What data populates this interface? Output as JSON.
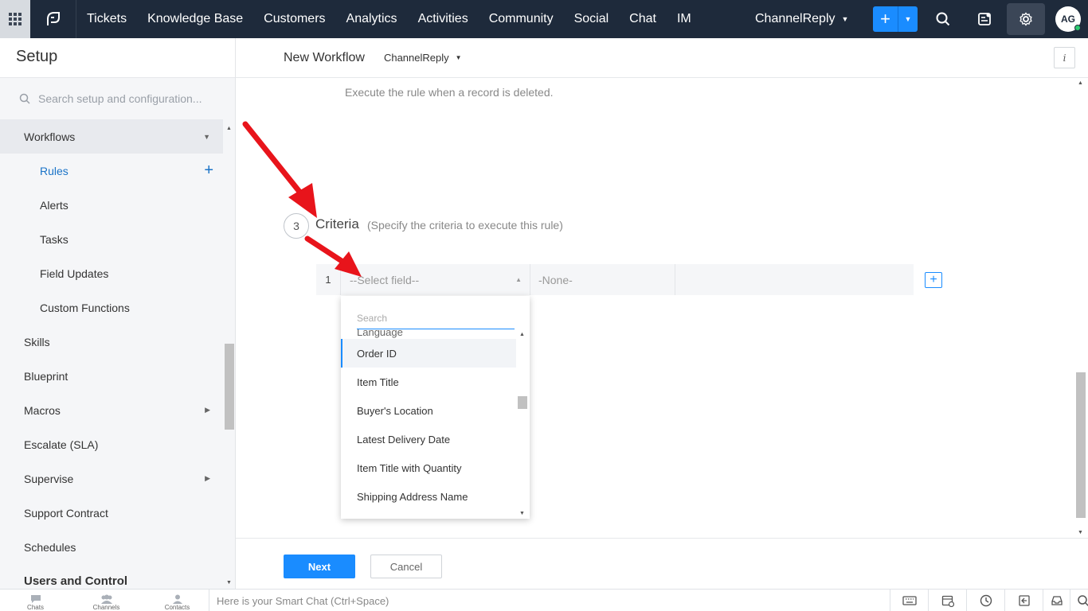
{
  "topnav": {
    "items": [
      "Tickets",
      "Knowledge Base",
      "Customers",
      "Analytics",
      "Activities",
      "Community",
      "Social",
      "Chat",
      "IM"
    ],
    "department": "ChannelReply",
    "avatar_initials": "AG"
  },
  "sidebar": {
    "title": "Setup",
    "search_placeholder": "Search setup and configuration...",
    "items": [
      {
        "label": "Workflows"
      },
      {
        "label": "Rules"
      },
      {
        "label": "Alerts"
      },
      {
        "label": "Tasks"
      },
      {
        "label": "Field Updates"
      },
      {
        "label": "Custom Functions"
      },
      {
        "label": "Skills"
      },
      {
        "label": "Blueprint"
      },
      {
        "label": "Macros"
      },
      {
        "label": "Escalate (SLA)"
      },
      {
        "label": "Supervise"
      },
      {
        "label": "Support Contract"
      },
      {
        "label": "Schedules"
      },
      {
        "label": "Users and Control"
      }
    ]
  },
  "main": {
    "title": "New Workflow",
    "department": "ChannelReply",
    "info_label": "i",
    "delete_text": "Execute the rule when a record is deleted.",
    "criteria": {
      "step": "3",
      "title": "Criteria",
      "description": "(Specify the criteria to execute this rule)",
      "row_number": "1",
      "field_placeholder": "--Select field--",
      "condition_placeholder": "-None-"
    },
    "dropdown": {
      "search_placeholder": "Search",
      "partial_item": "Language",
      "items": [
        "Order ID",
        "Item Title",
        "Buyer's Location",
        "Latest Delivery Date",
        "Item Title with Quantity",
        "Shipping Address Name"
      ]
    },
    "next_label": "Next",
    "cancel_label": "Cancel"
  },
  "bottombar": {
    "tabs": [
      "Chats",
      "Channels",
      "Contacts"
    ],
    "smart_chat": "Here is your Smart Chat (Ctrl+Space)"
  },
  "colors": {
    "nav_bg": "#1e2a3b",
    "accent": "#1a8cff",
    "annotation_arrow": "#e8141b"
  }
}
